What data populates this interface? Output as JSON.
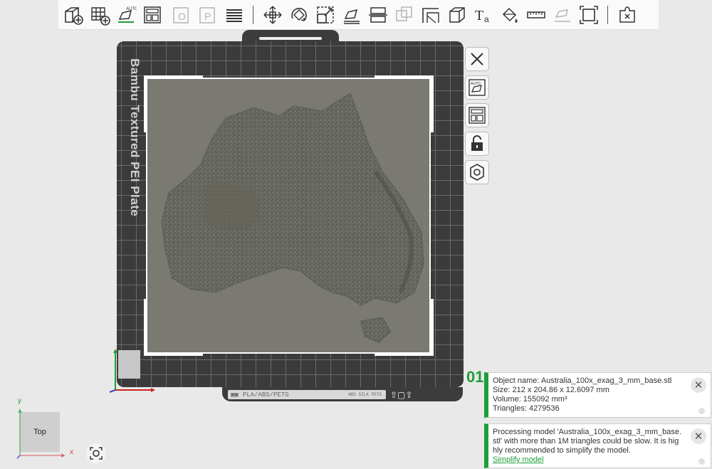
{
  "toolbar": {
    "items": [
      {
        "name": "add-object",
        "icon": "cube-plus-icon",
        "enabled": true
      },
      {
        "name": "add-plate",
        "icon": "grid-plus-icon",
        "enabled": true
      },
      {
        "name": "auto-orient",
        "icon": "auto-orient-icon",
        "enabled": true
      },
      {
        "name": "arrange",
        "icon": "arrange-icon",
        "enabled": true
      },
      {
        "name": "split-objects",
        "icon": "split-objects-icon",
        "enabled": false
      },
      {
        "name": "split-parts",
        "icon": "split-parts-icon",
        "enabled": false
      },
      {
        "name": "layers",
        "icon": "layers-icon",
        "enabled": true
      },
      {
        "name": "move",
        "icon": "move-icon",
        "enabled": true
      },
      {
        "name": "rotate",
        "icon": "rotate-icon",
        "enabled": true
      },
      {
        "name": "scale",
        "icon": "scale-icon",
        "enabled": true
      },
      {
        "name": "lay-on-face",
        "icon": "lay-on-face-icon",
        "enabled": true
      },
      {
        "name": "cut",
        "icon": "cut-icon",
        "enabled": true
      },
      {
        "name": "boolean",
        "icon": "boolean-icon",
        "enabled": false
      },
      {
        "name": "support-paint",
        "icon": "support-paint-icon",
        "enabled": true
      },
      {
        "name": "seam-paint",
        "icon": "seam-paint-icon",
        "enabled": true
      },
      {
        "name": "text",
        "icon": "text-icon",
        "enabled": true
      },
      {
        "name": "color-paint",
        "icon": "color-paint-icon",
        "enabled": true
      },
      {
        "name": "measure",
        "icon": "ruler-icon",
        "enabled": true
      },
      {
        "name": "assembly",
        "icon": "assembly-icon",
        "enabled": false
      },
      {
        "name": "fit-view",
        "icon": "fit-view-icon",
        "enabled": true
      },
      {
        "name": "assembly-view",
        "icon": "puzzle-icon",
        "enabled": true
      }
    ]
  },
  "plate": {
    "label": "Bambu Textured PEI Plate",
    "info_text": "PLA/ABS/PETG",
    "info_small": "ABS SILK PETG",
    "number": "01"
  },
  "side_buttons": [
    {
      "name": "remove-plate",
      "icon": "close-icon"
    },
    {
      "name": "auto-orient-plate",
      "icon": "auto-orient-icon"
    },
    {
      "name": "arrange-plate",
      "icon": "arrange-icon"
    },
    {
      "name": "lock-plate",
      "icon": "lock-icon"
    },
    {
      "name": "plate-settings",
      "icon": "gear-icon"
    }
  ],
  "notifications": {
    "object_info": {
      "name_line": "Object name: Australia_100x_exag_3_mm_base.stl",
      "size_line": "Size: 212 x 204.86 x 12.6097 mm",
      "volume_line": "Volume: 155092 mm³",
      "triangles_line": "Triangles: 4279536"
    },
    "warning": {
      "message": "Processing model 'Australia_100x_exag_3_mm_base.stl' with more than 1M triangles could be slow. It is highly recommended to simplify the model.",
      "link": "Simplify model"
    }
  },
  "viewcube": {
    "face_label": "Top",
    "x_axis": "x",
    "y_axis": "y"
  },
  "colors": {
    "accent": "#1e9e3a",
    "plate": "#3b3b3b",
    "model": "#7a7a73"
  }
}
